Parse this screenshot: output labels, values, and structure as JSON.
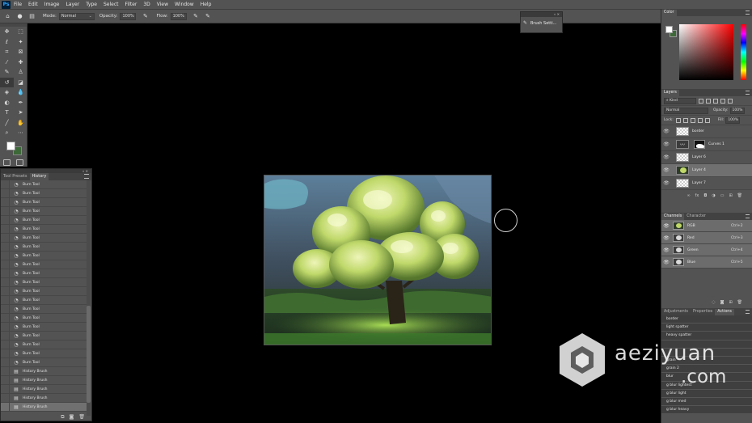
{
  "menubar": {
    "logo": "Ps",
    "items": [
      "File",
      "Edit",
      "Image",
      "Layer",
      "Type",
      "Select",
      "Filter",
      "3D",
      "View",
      "Window",
      "Help"
    ]
  },
  "options": {
    "mode_label": "Mode:",
    "mode_value": "Normal",
    "opacity_label": "Opacity:",
    "opacity_value": "100%",
    "flow_label": "Flow:",
    "flow_value": "100%"
  },
  "history_panel": {
    "tabs": [
      "Tool Presets",
      "History"
    ],
    "active_tab": "History",
    "items": [
      {
        "label": "Burn Tool",
        "icon": "burn-tool-icon"
      },
      {
        "label": "Burn Tool",
        "icon": "burn-tool-icon"
      },
      {
        "label": "Burn Tool",
        "icon": "burn-tool-icon"
      },
      {
        "label": "Burn Tool",
        "icon": "burn-tool-icon"
      },
      {
        "label": "Burn Tool",
        "icon": "burn-tool-icon"
      },
      {
        "label": "Burn Tool",
        "icon": "burn-tool-icon"
      },
      {
        "label": "Burn Tool",
        "icon": "burn-tool-icon"
      },
      {
        "label": "Burn Tool",
        "icon": "burn-tool-icon"
      },
      {
        "label": "Burn Tool",
        "icon": "burn-tool-icon"
      },
      {
        "label": "Burn Tool",
        "icon": "burn-tool-icon"
      },
      {
        "label": "Burn Tool",
        "icon": "burn-tool-icon"
      },
      {
        "label": "Burn Tool",
        "icon": "burn-tool-icon"
      },
      {
        "label": "Burn Tool",
        "icon": "burn-tool-icon"
      },
      {
        "label": "Burn Tool",
        "icon": "burn-tool-icon"
      },
      {
        "label": "Burn Tool",
        "icon": "burn-tool-icon"
      },
      {
        "label": "Burn Tool",
        "icon": "burn-tool-icon"
      },
      {
        "label": "Burn Tool",
        "icon": "burn-tool-icon"
      },
      {
        "label": "Burn Tool",
        "icon": "burn-tool-icon"
      },
      {
        "label": "Burn Tool",
        "icon": "burn-tool-icon"
      },
      {
        "label": "Burn Tool",
        "icon": "burn-tool-icon"
      },
      {
        "label": "Burn Tool",
        "icon": "burn-tool-icon"
      },
      {
        "label": "History Brush",
        "icon": "history-brush-icon"
      },
      {
        "label": "History Brush",
        "icon": "history-brush-icon"
      },
      {
        "label": "History Brush",
        "icon": "history-brush-icon"
      },
      {
        "label": "History Brush",
        "icon": "history-brush-icon"
      },
      {
        "label": "History Brush",
        "icon": "history-brush-icon"
      }
    ],
    "selected_index": 25
  },
  "brush_popup": {
    "label": "Brush Setti..."
  },
  "color_panel": {
    "title": "Color",
    "foreground": "#ffffff",
    "background": "#3d6838"
  },
  "layers_panel": {
    "title": "Layers",
    "filter_value": "Kind",
    "blend_value": "Normal",
    "opacity_label": "Opacity:",
    "opacity_value": "100%",
    "lock_label": "Lock:",
    "fill_label": "Fill:",
    "fill_value": "100%",
    "layers": [
      {
        "name": "border",
        "thumb": "check"
      },
      {
        "name": "Curves 1",
        "thumb": "curves"
      },
      {
        "name": "Layer 6",
        "thumb": "check"
      },
      {
        "name": "Layer 4",
        "thumb": "tree"
      },
      {
        "name": "Layer 7",
        "thumb": "check"
      }
    ],
    "selected_index": 3
  },
  "channels_panel": {
    "tabs": [
      "Channels",
      "Character"
    ],
    "active_tab": "Channels",
    "channels": [
      {
        "name": "RGB",
        "shortcut": "Ctrl+2"
      },
      {
        "name": "Red",
        "shortcut": "Ctrl+3"
      },
      {
        "name": "Green",
        "shortcut": "Ctrl+4"
      },
      {
        "name": "Blue",
        "shortcut": "Ctrl+5"
      }
    ]
  },
  "actions_panel": {
    "tabs": [
      "Adjustments",
      "Properties",
      "Actions"
    ],
    "active_tab": "Actions",
    "items": [
      "border",
      "light spatter",
      "heavy spatter",
      "",
      "",
      "grain",
      "grain 2",
      "blur",
      "g blur lightest",
      "g blur light",
      "g blur med",
      "g blur heavy"
    ]
  },
  "watermark": {
    "line1": "aeziyuan",
    "line2": ".com"
  }
}
